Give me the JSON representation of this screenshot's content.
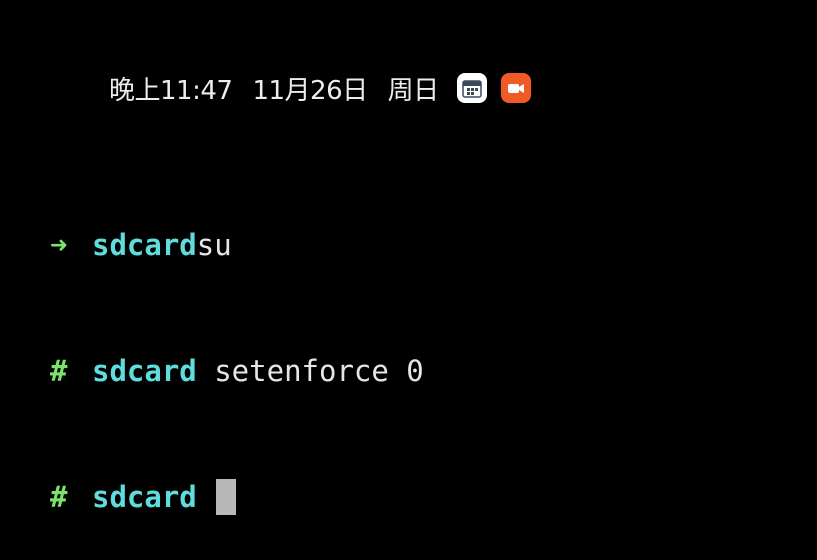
{
  "status_bar": {
    "time": "晚上11:47",
    "date": "11月26日",
    "weekday": "周日",
    "icons": [
      "calendar-app-icon",
      "camera-app-icon"
    ]
  },
  "terminal": {
    "lines": [
      {
        "prompt": "➜",
        "cwd": "sdcard",
        "command": "su"
      },
      {
        "prompt": "#",
        "cwd": "sdcard",
        "command": " setenforce 0"
      },
      {
        "prompt": "#",
        "cwd": "sdcard",
        "command": ""
      }
    ]
  },
  "colors": {
    "background": "#000000",
    "prompt": "#7be36b",
    "cwd": "#5fdcdc",
    "command": "#e6e6e6",
    "cursor": "#b8b8b8",
    "camera_icon": "#f15a24"
  }
}
